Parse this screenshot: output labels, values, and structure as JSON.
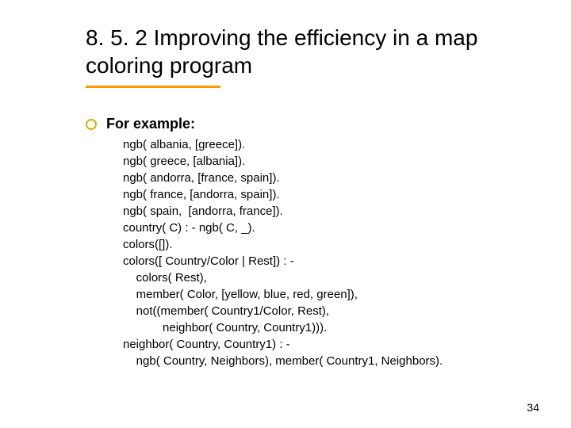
{
  "title": "8. 5. 2 Improving the efficiency in a map coloring program",
  "bullet_label": "For example:",
  "code": "ngb( albania, [greece]).\nngb( greece, [albania]).\nngb( andorra, [france, spain]).\nngb( france, [andorra, spain]).\nngb( spain,  [andorra, france]).\ncountry( C) : - ngb( C, _).\ncolors([]).\ncolors([ Country/Color | Rest]) : -\n    colors( Rest),\n    member( Color, [yellow, blue, red, green]),\n    not((member( Country1/Color, Rest),\n            neighbor( Country, Country1))).\nneighbor( Country, Country1) : -\n    ngb( Country, Neighbors), member( Country1, Neighbors).",
  "page_number": "34"
}
